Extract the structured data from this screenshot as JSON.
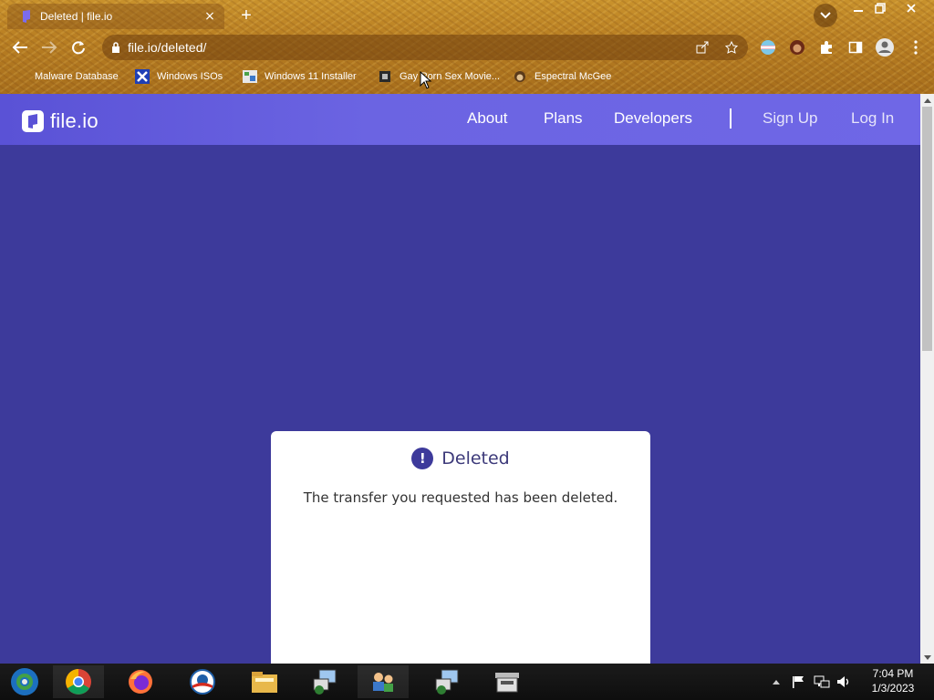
{
  "browser": {
    "tab": {
      "title": "Deleted | file.io",
      "close_glyph": "×"
    },
    "new_tab_glyph": "+",
    "address": "file.io/deleted/",
    "bookmarks": [
      {
        "label": "Malware Database",
        "icon": "none"
      },
      {
        "label": "Windows ISOs",
        "icon": "x-logo-icon"
      },
      {
        "label": "Windows 11 Installer",
        "icon": "image-icon"
      },
      {
        "label": "Gay Porn Sex Movie...",
        "icon": "film-icon"
      },
      {
        "label": "Espectral McGee",
        "icon": "face-icon"
      }
    ]
  },
  "site": {
    "logo_text": "file.io",
    "nav": {
      "about": "About",
      "plans": "Plans",
      "developers": "Developers",
      "signup": "Sign Up",
      "login": "Log In"
    },
    "card": {
      "icon_glyph": "!",
      "title": "Deleted",
      "message": "The transfer you requested has been deleted."
    }
  },
  "taskbar": {
    "time": "7:04 PM",
    "date": "1/3/2023"
  },
  "colors": {
    "page_bg": "#3d3a9b",
    "nav_bg": "#6b64e2",
    "card_bg": "#ffffff"
  }
}
